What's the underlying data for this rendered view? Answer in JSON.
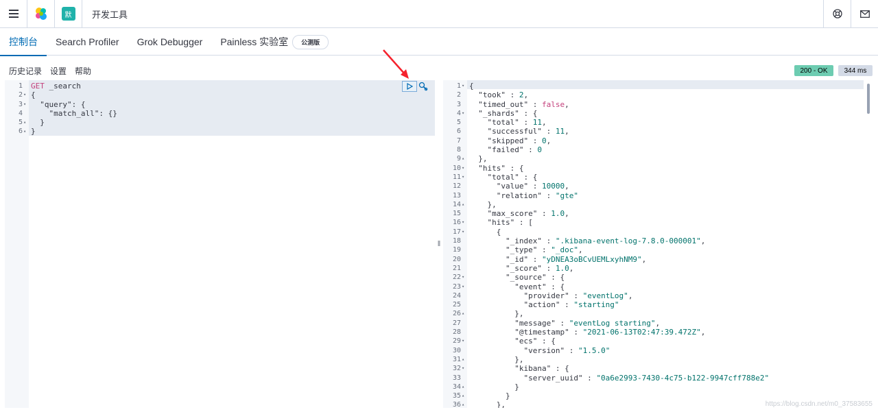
{
  "header": {
    "space_initial": "默",
    "breadcrumb": "开发工具"
  },
  "tabs": [
    {
      "label": "控制台",
      "active": true
    },
    {
      "label": "Search Profiler",
      "active": false
    },
    {
      "label": "Grok Debugger",
      "active": false
    },
    {
      "label": "Painless 实验室",
      "active": false,
      "badge": "公测版"
    }
  ],
  "console_menu": {
    "history": "历史记录",
    "settings": "设置",
    "help": "帮助"
  },
  "status": {
    "code": "200 - OK",
    "time": "344 ms",
    "color": "#6dccb1"
  },
  "request": {
    "line_numbers": [
      "1",
      "2",
      "3",
      "4",
      "5",
      "6"
    ],
    "lines": [
      [
        {
          "t": "kw",
          "v": "GET"
        },
        {
          "t": "k",
          "v": " _search"
        }
      ],
      [
        {
          "t": "k",
          "v": "{"
        }
      ],
      [
        {
          "t": "k",
          "v": "  \"query\": {"
        }
      ],
      [
        {
          "t": "k",
          "v": "    \"match_all\": {}"
        }
      ],
      [
        {
          "t": "k",
          "v": "  }"
        }
      ],
      [
        {
          "t": "k",
          "v": "}"
        }
      ]
    ],
    "folds": [
      "",
      "▾",
      "▾",
      "",
      "▴",
      "▴"
    ]
  },
  "response": {
    "line_numbers": [
      "1",
      "2",
      "3",
      "4",
      "5",
      "6",
      "7",
      "8",
      "9",
      "10",
      "11",
      "12",
      "13",
      "14",
      "15",
      "16",
      "17",
      "18",
      "19",
      "20",
      "21",
      "22",
      "23",
      "24",
      "25",
      "26",
      "27",
      "28",
      "29",
      "30",
      "31",
      "32",
      "33",
      "34",
      "35",
      "36"
    ],
    "folds": [
      "▾",
      "",
      "",
      "▾",
      "",
      "",
      "",
      "",
      "▴",
      "▾",
      "▾",
      "",
      "",
      "▴",
      "",
      "▾",
      "▾",
      "",
      "",
      "",
      "",
      "▾",
      "▾",
      "",
      "",
      "▴",
      "",
      "",
      "▾",
      "",
      "▴",
      "▾",
      "",
      "▴",
      "▴",
      "▴"
    ],
    "lines": [
      [
        {
          "t": "k",
          "v": "{"
        }
      ],
      [
        {
          "t": "k",
          "v": "  \"took\" : "
        },
        {
          "t": "num",
          "v": "2"
        },
        {
          "t": "k",
          "v": ","
        }
      ],
      [
        {
          "t": "k",
          "v": "  \"timed_out\" : "
        },
        {
          "t": "bool",
          "v": "false"
        },
        {
          "t": "k",
          "v": ","
        }
      ],
      [
        {
          "t": "k",
          "v": "  \"_shards\" : {"
        }
      ],
      [
        {
          "t": "k",
          "v": "    \"total\" : "
        },
        {
          "t": "num",
          "v": "11"
        },
        {
          "t": "k",
          "v": ","
        }
      ],
      [
        {
          "t": "k",
          "v": "    \"successful\" : "
        },
        {
          "t": "num",
          "v": "11"
        },
        {
          "t": "k",
          "v": ","
        }
      ],
      [
        {
          "t": "k",
          "v": "    \"skipped\" : "
        },
        {
          "t": "num",
          "v": "0"
        },
        {
          "t": "k",
          "v": ","
        }
      ],
      [
        {
          "t": "k",
          "v": "    \"failed\" : "
        },
        {
          "t": "num",
          "v": "0"
        }
      ],
      [
        {
          "t": "k",
          "v": "  },"
        }
      ],
      [
        {
          "t": "k",
          "v": "  \"hits\" : {"
        }
      ],
      [
        {
          "t": "k",
          "v": "    \"total\" : {"
        }
      ],
      [
        {
          "t": "k",
          "v": "      \"value\" : "
        },
        {
          "t": "num",
          "v": "10000"
        },
        {
          "t": "k",
          "v": ","
        }
      ],
      [
        {
          "t": "k",
          "v": "      \"relation\" : "
        },
        {
          "t": "str",
          "v": "\"gte\""
        }
      ],
      [
        {
          "t": "k",
          "v": "    },"
        }
      ],
      [
        {
          "t": "k",
          "v": "    \"max_score\" : "
        },
        {
          "t": "num",
          "v": "1.0"
        },
        {
          "t": "k",
          "v": ","
        }
      ],
      [
        {
          "t": "k",
          "v": "    \"hits\" : ["
        }
      ],
      [
        {
          "t": "k",
          "v": "      {"
        }
      ],
      [
        {
          "t": "k",
          "v": "        \"_index\" : "
        },
        {
          "t": "str",
          "v": "\".kibana-event-log-7.8.0-000001\""
        },
        {
          "t": "k",
          "v": ","
        }
      ],
      [
        {
          "t": "k",
          "v": "        \"_type\" : "
        },
        {
          "t": "str",
          "v": "\"_doc\""
        },
        {
          "t": "k",
          "v": ","
        }
      ],
      [
        {
          "t": "k",
          "v": "        \"_id\" : "
        },
        {
          "t": "str",
          "v": "\"yDNEA3oBCvUEMLxyhNM9\""
        },
        {
          "t": "k",
          "v": ","
        }
      ],
      [
        {
          "t": "k",
          "v": "        \"_score\" : "
        },
        {
          "t": "num",
          "v": "1.0"
        },
        {
          "t": "k",
          "v": ","
        }
      ],
      [
        {
          "t": "k",
          "v": "        \"_source\" : {"
        }
      ],
      [
        {
          "t": "k",
          "v": "          \"event\" : {"
        }
      ],
      [
        {
          "t": "k",
          "v": "            \"provider\" : "
        },
        {
          "t": "str",
          "v": "\"eventLog\""
        },
        {
          "t": "k",
          "v": ","
        }
      ],
      [
        {
          "t": "k",
          "v": "            \"action\" : "
        },
        {
          "t": "str",
          "v": "\"starting\""
        }
      ],
      [
        {
          "t": "k",
          "v": "          },"
        }
      ],
      [
        {
          "t": "k",
          "v": "          \"message\" : "
        },
        {
          "t": "str",
          "v": "\"eventLog starting\""
        },
        {
          "t": "k",
          "v": ","
        }
      ],
      [
        {
          "t": "k",
          "v": "          \"@timestamp\" : "
        },
        {
          "t": "str",
          "v": "\"2021-06-13T02:47:39.472Z\""
        },
        {
          "t": "k",
          "v": ","
        }
      ],
      [
        {
          "t": "k",
          "v": "          \"ecs\" : {"
        }
      ],
      [
        {
          "t": "k",
          "v": "            \"version\" : "
        },
        {
          "t": "str",
          "v": "\"1.5.0\""
        }
      ],
      [
        {
          "t": "k",
          "v": "          },"
        }
      ],
      [
        {
          "t": "k",
          "v": "          \"kibana\" : {"
        }
      ],
      [
        {
          "t": "k",
          "v": "            \"server_uuid\" : "
        },
        {
          "t": "str",
          "v": "\"0a6e2993-7430-4c75-b122-9947cff788e2\""
        }
      ],
      [
        {
          "t": "k",
          "v": "          }"
        }
      ],
      [
        {
          "t": "k",
          "v": "        }"
        }
      ],
      [
        {
          "t": "k",
          "v": "      },"
        }
      ]
    ]
  },
  "divider_glyph": "‖",
  "watermark": "https://blog.csdn.net/m0_37583655"
}
